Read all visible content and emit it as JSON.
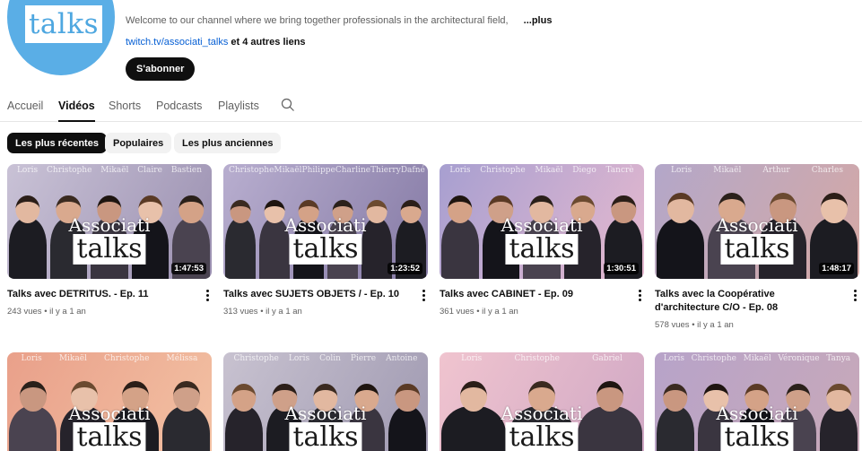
{
  "channel": {
    "avatar_text": "talks",
    "description": "Welcome to our channel where we bring together professionals in the architectural field,",
    "more_label": "...plus",
    "link": "twitch.tv/associati_talks",
    "link_suffix": "et 4 autres liens",
    "subscribe_label": "S'abonner"
  },
  "tabs": [
    {
      "label": "Accueil",
      "active": false
    },
    {
      "label": "Vidéos",
      "active": true
    },
    {
      "label": "Shorts",
      "active": false
    },
    {
      "label": "Podcasts",
      "active": false
    },
    {
      "label": "Playlists",
      "active": false
    }
  ],
  "search_icon": "search-icon",
  "chips": [
    {
      "label": "Les plus récentes",
      "active": true
    },
    {
      "label": "Populaires",
      "active": false
    },
    {
      "label": "Les plus anciennes",
      "active": false
    }
  ],
  "thumbnail_logo": {
    "line1": "Associati",
    "line2": "talks"
  },
  "videos": [
    {
      "title": "Talks avec DETRITUS. - Ep. 11",
      "views": "243 vues",
      "age": "il y a 1 an",
      "duration": "1:47:53",
      "names": [
        "Loris",
        "Christophe",
        "Mikaël",
        "Claire",
        "Bastien"
      ],
      "bg": [
        "#c9c2d6",
        "#9a8fb0"
      ]
    },
    {
      "title": "Talks avec SUJETS OBJETS / - Ep. 10",
      "views": "313 vues",
      "age": "il y a 1 an",
      "duration": "1:23:52",
      "names": [
        "Christophe",
        "Mikaël",
        "Philippe",
        "Charline",
        "Thierry",
        "Dafné"
      ],
      "bg": [
        "#b8aecf",
        "#857aa5"
      ]
    },
    {
      "title": "Talks avec CABINET - Ep. 09",
      "views": "361 vues",
      "age": "il y a 1 an",
      "duration": "1:30:51",
      "names": [
        "Loris",
        "Christophe",
        "Mikaël",
        "Diego",
        "Tancrè"
      ],
      "bg": [
        "#a79fd0",
        "#e6b9cf"
      ]
    },
    {
      "title": "Talks avec la Coopérative d'architecture C/O - Ep. 08",
      "views": "578 vues",
      "age": "il y a 1 an",
      "duration": "1:48:17",
      "names": [
        "Loris",
        "Mikaël",
        "Arthur",
        "Charles"
      ],
      "bg": [
        "#b3a7c9",
        "#d6a9a4"
      ]
    },
    {
      "title": "",
      "views": "",
      "age": "",
      "duration": "",
      "names": [
        "Loris",
        "Mikaël",
        "Christophe",
        "Mélissa"
      ],
      "bg": [
        "#e9a08a",
        "#f3c2a4"
      ]
    },
    {
      "title": "",
      "views": "",
      "age": "",
      "duration": "",
      "names": [
        "Christophe",
        "Loris",
        "Colin",
        "Pierre",
        "Antoine"
      ],
      "bg": [
        "#c8c2d0",
        "#9e98b0"
      ]
    },
    {
      "title": "",
      "views": "",
      "age": "",
      "duration": "",
      "names": [
        "Loris",
        "Christophe",
        "Gabriel"
      ],
      "bg": [
        "#f0c4cf",
        "#cfa7c4"
      ]
    },
    {
      "title": "",
      "views": "",
      "age": "",
      "duration": "",
      "names": [
        "Loris",
        "Christophe",
        "Mikaël",
        "Véronique",
        "Tanya"
      ],
      "bg": [
        "#b7a3c9",
        "#c9a9b8"
      ]
    }
  ]
}
